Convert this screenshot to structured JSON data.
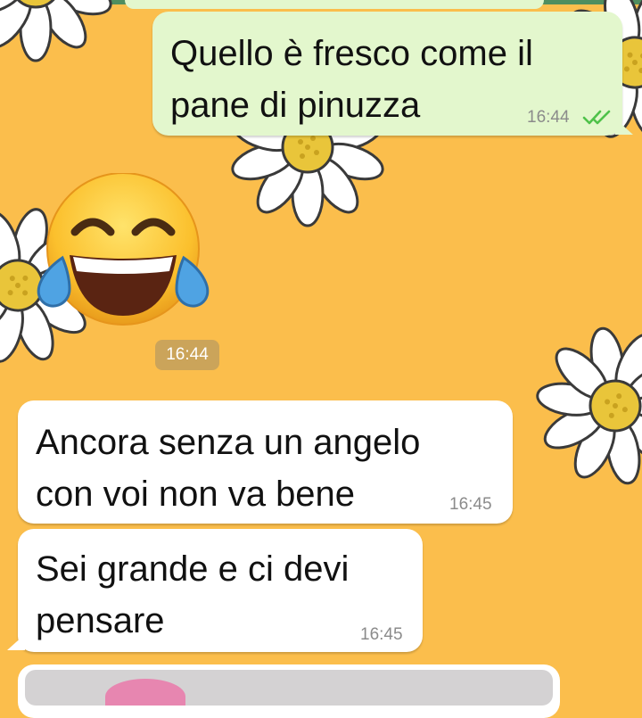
{
  "colors": {
    "wallpaper": "#fbbe4c",
    "outgoing_bubble": "#e3f7cd",
    "incoming_bubble": "#ffffff",
    "read_ticks": "#4fc24a",
    "emoji_time_badge": "#cba45a"
  },
  "messages": [
    {
      "direction": "outgoing",
      "lines": [
        "Quello è fresco come il",
        "pane di pinuzza"
      ],
      "time": "16:44",
      "status_icon": "double-check-read-icon"
    },
    {
      "direction": "incoming",
      "emoji_name": "face-with-tears-of-joy",
      "time": "16:44"
    },
    {
      "direction": "incoming",
      "lines": [
        "Ancora senza un angelo",
        "con voi non va bene"
      ],
      "time": "16:45"
    },
    {
      "direction": "incoming",
      "lines": [
        "Sei grande e ci devi",
        "pensare"
      ],
      "time": "16:45"
    }
  ]
}
